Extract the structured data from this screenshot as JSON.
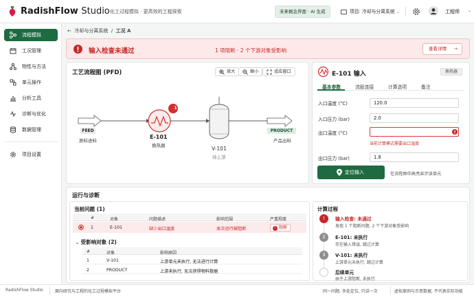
{
  "app": {
    "brand_bold": "RadishFlow",
    "brand_light": "Studio",
    "tagline": "化工过程模拟 · 更高效的工程探索",
    "mode_pill": "未来概念界面 · AI 生成",
    "project": "项目: 冷却与分离系统",
    "user": "工程师"
  },
  "sidebar": {
    "items": [
      {
        "label": "流程模拟",
        "icon": "flowchart-icon"
      },
      {
        "label": "工况管理",
        "icon": "calendar-icon"
      },
      {
        "label": "物性与方法",
        "icon": "molecule-icon"
      },
      {
        "label": "单元操作",
        "icon": "units-icon"
      },
      {
        "label": "分析工具",
        "icon": "chart-icon"
      },
      {
        "label": "诊断与优化",
        "icon": "pulse-icon"
      },
      {
        "label": "数据管理",
        "icon": "database-icon"
      },
      {
        "label": "项目设置",
        "icon": "gear-icon"
      }
    ]
  },
  "breadcrumb": {
    "parent": "冷却与分离系统",
    "current": "工况 A"
  },
  "alert": {
    "title": "输入检查未通过",
    "summary": "1 项阻断 · 2 个下游对象受影响",
    "button": "查看详情"
  },
  "pfd": {
    "title": "工艺流程图 (PFD)",
    "zoom_in": "放大",
    "zoom_out": "缩小",
    "fit": "适应窗口",
    "feed_tag": "FEED",
    "feed_desc": "原料进料",
    "e101_tag": "E-101",
    "e101_desc": "换热器",
    "e101_badge": "1",
    "v101_tag": "V-101",
    "v101_desc": "待上游",
    "product_tag": "PRODUCT",
    "product_desc": "产品出料"
  },
  "inspector": {
    "title": "E-101 输入",
    "type_badge": "换热器",
    "tabs": [
      "基本参数",
      "流股连接",
      "计算选项",
      "备注"
    ],
    "fields": [
      {
        "label": "入口温度 (°C)",
        "value": "120.0"
      },
      {
        "label": "入口压力 (bar)",
        "value": "2.0"
      },
      {
        "label": "出口温度 (°C)",
        "value": ""
      },
      {
        "label": "出口压力 (bar)",
        "value": "1.8"
      }
    ],
    "error": "当前计算模式需要出口温度",
    "locate_button": "定位输入",
    "hint": "在流程图中高亮显示该单元"
  },
  "diagnostics": {
    "title": "运行与诊断",
    "current_title": "当前问题 (1)",
    "columns": [
      "#",
      "对象",
      "问题描述",
      "影响范围",
      "严重程度"
    ],
    "issue": {
      "no": "1",
      "obj": "E-101",
      "desc": "缺少出口温度",
      "scope": "本次运行被阻断",
      "severity": "阻断"
    },
    "affected_title": "受影响对象 (2)",
    "affected_columns": [
      "#",
      "对象",
      "影响原因"
    ],
    "affected": [
      {
        "no": "1",
        "obj": "V-101",
        "reason": "上游单元未执行, 无法进行计算"
      },
      {
        "no": "2",
        "obj": "PRODUCT",
        "reason": "上游未执行, 无法获得物料数据"
      }
    ]
  },
  "calc": {
    "title": "计算过程",
    "steps": [
      {
        "mark": "!",
        "title": "输入检查: 未通过",
        "desc": "发现 1 个阻断问题, 2 个下游对象受影响"
      },
      {
        "mark": "2",
        "title": "E-101: 未执行",
        "desc": "存在输入错误, 跳过计算"
      },
      {
        "mark": "3",
        "title": "V-101: 未执行",
        "desc": "上游单元未执行, 跳过计算"
      },
      {
        "mark": "",
        "title": "后续单元",
        "desc": "由于上游阻断, 未执行"
      }
    ]
  },
  "footer": {
    "left1": "RadishFlow Studio",
    "left2": "面向研究与工程的化工过程模拟平台",
    "right1": "同一问题, 多处定位, 只讲一次",
    "right2": "虚拟案例与示意数据, 不代表实际功能"
  },
  "colors": {
    "brand_green": "#1f6b41",
    "error_red": "#c62828",
    "alert_bg": "#fde9e9"
  }
}
